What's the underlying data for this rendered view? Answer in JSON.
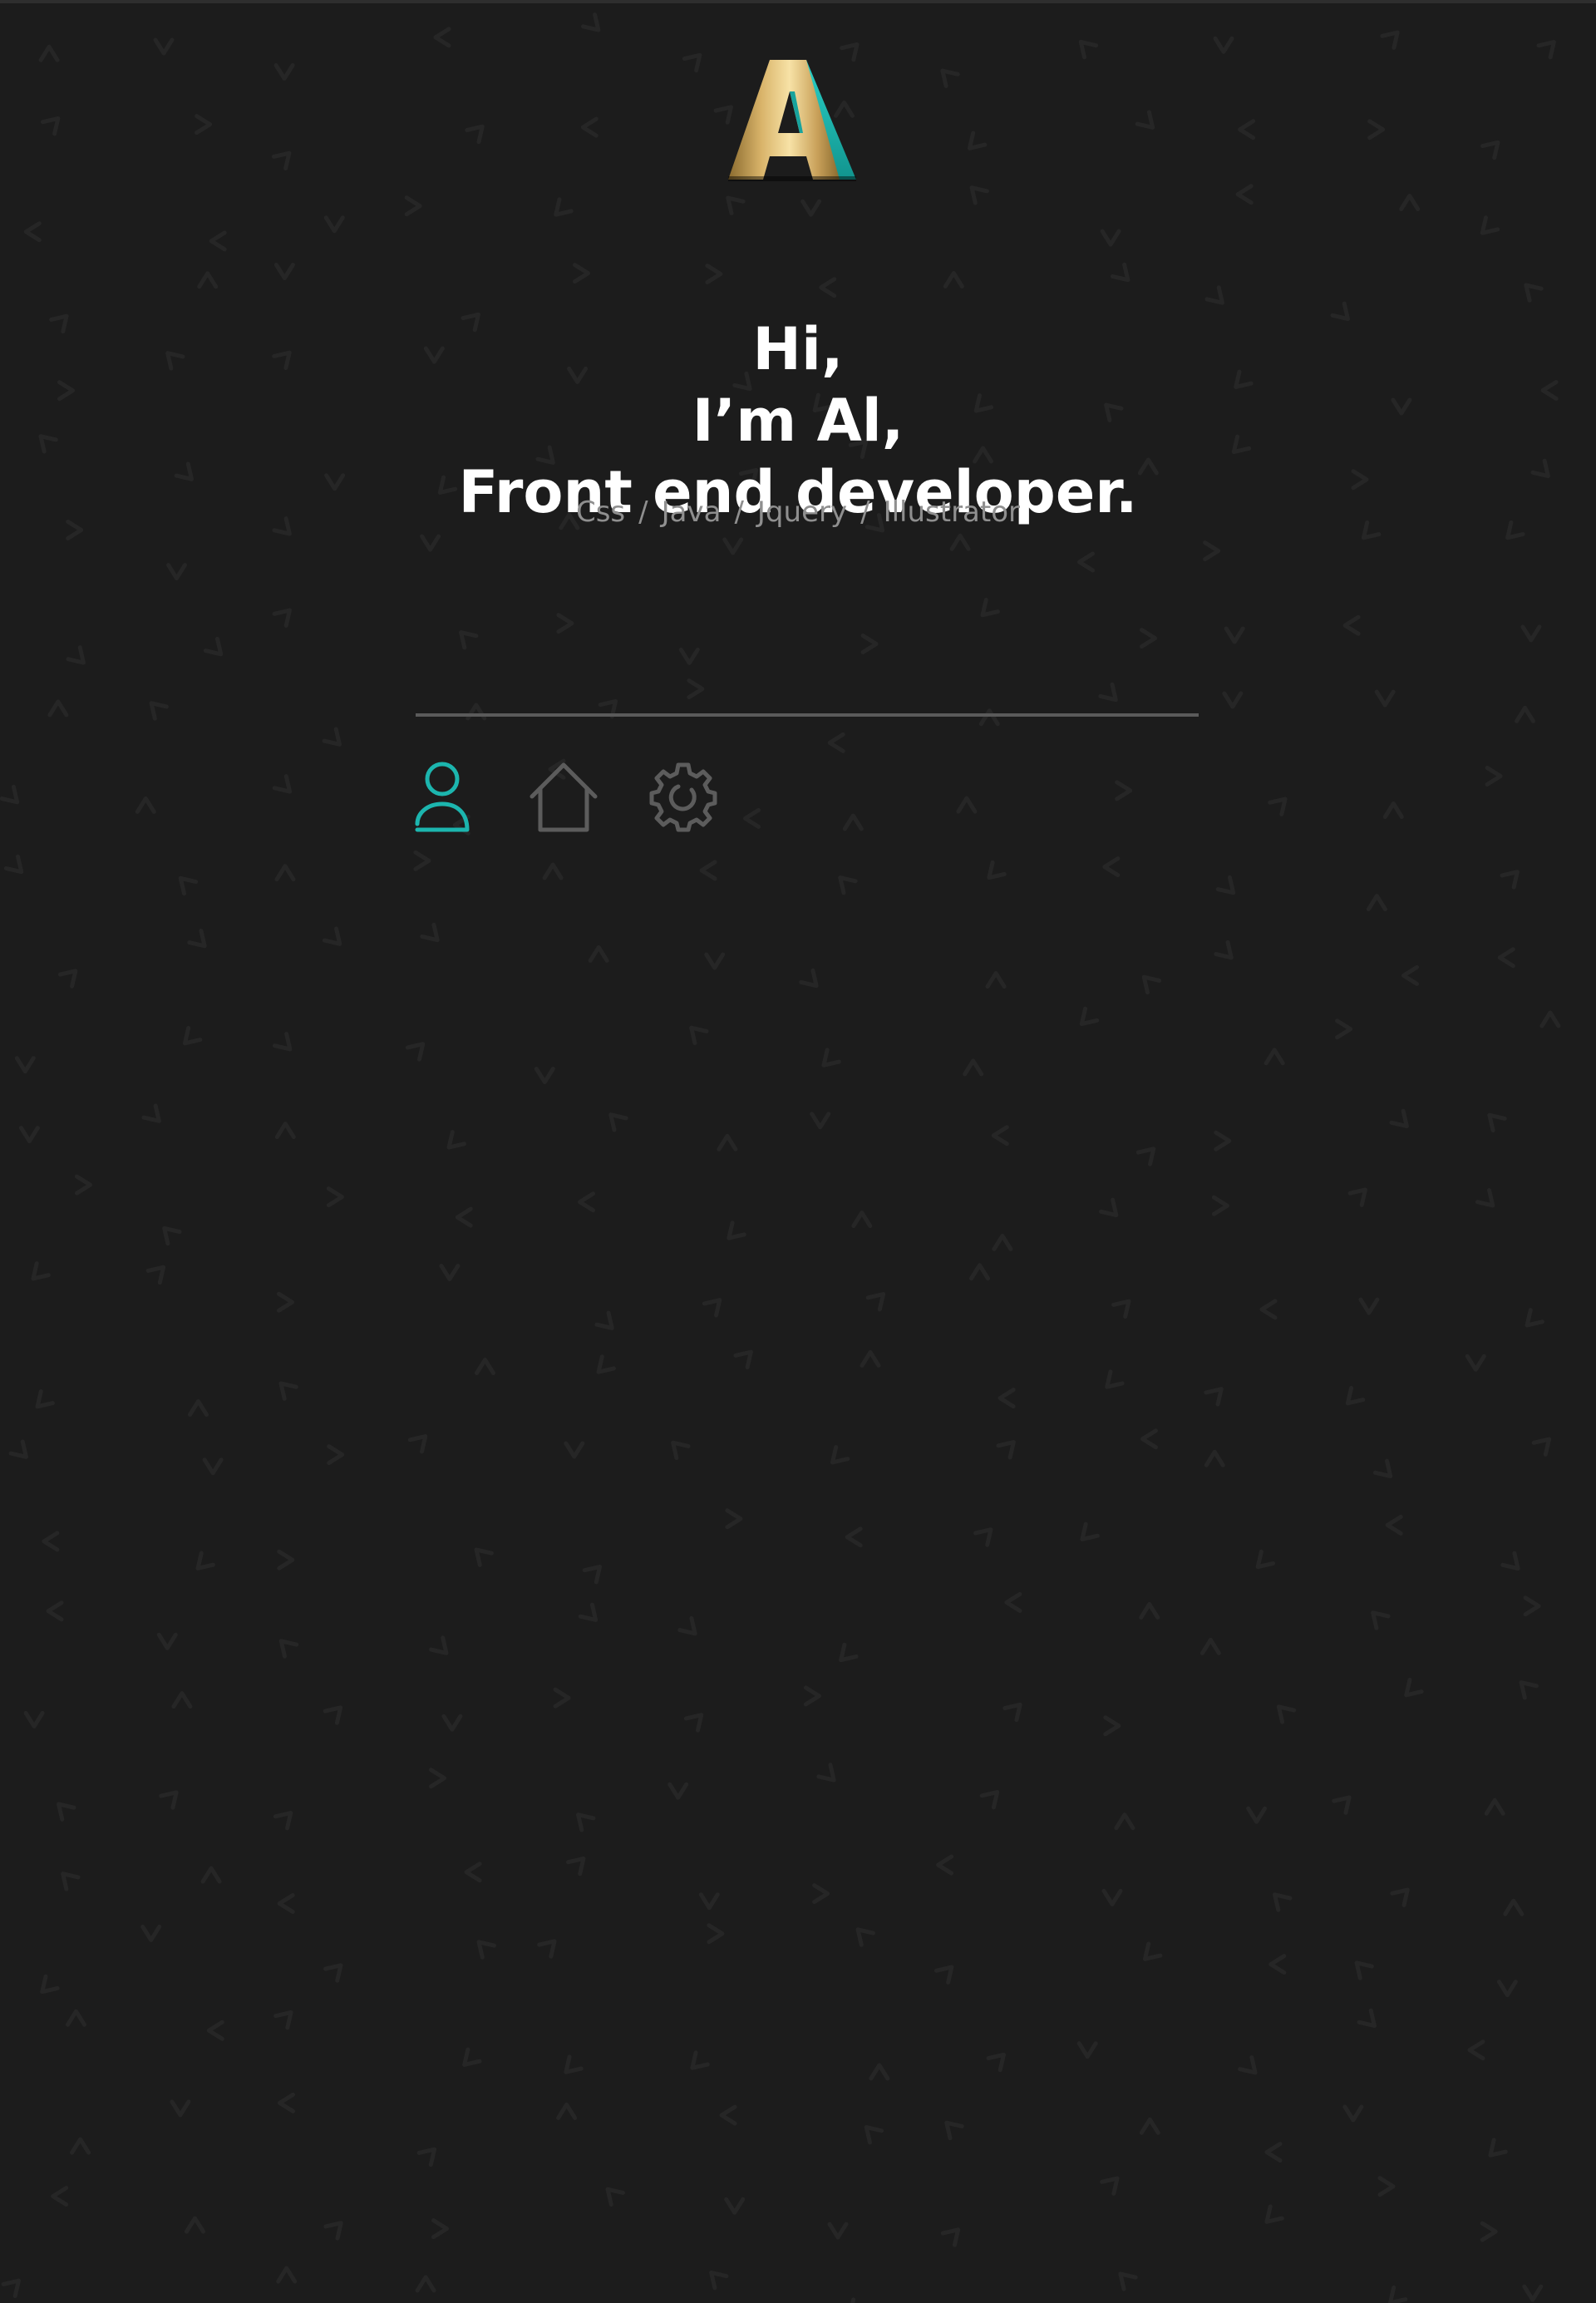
{
  "brand": {
    "logo_letter": "A",
    "logo_icon": "gold-letter-a-logo-icon",
    "colors": {
      "gold": "#e7c377",
      "teal": "#1cb5ae"
    }
  },
  "hero": {
    "greeting": "Hi,",
    "name_line": "I’m Al,",
    "role_line": "Front end developer."
  },
  "skills": {
    "items": [
      "Css",
      "Java",
      "Jquery",
      "Illustrator"
    ],
    "separator": "/"
  },
  "nav": {
    "items": [
      {
        "icon": "user-icon",
        "active": true
      },
      {
        "icon": "home-icon",
        "active": false
      },
      {
        "icon": "gear-icon",
        "active": false
      }
    ],
    "active_color": "#1cb5ae",
    "inactive_color": "#5c5c5c"
  },
  "theme": {
    "background": "#1c1c1c",
    "pattern_color": "#262626",
    "heading_color": "#ffffff",
    "skills_color": "#8f8f8f",
    "divider_color": "#5a5a5a"
  }
}
